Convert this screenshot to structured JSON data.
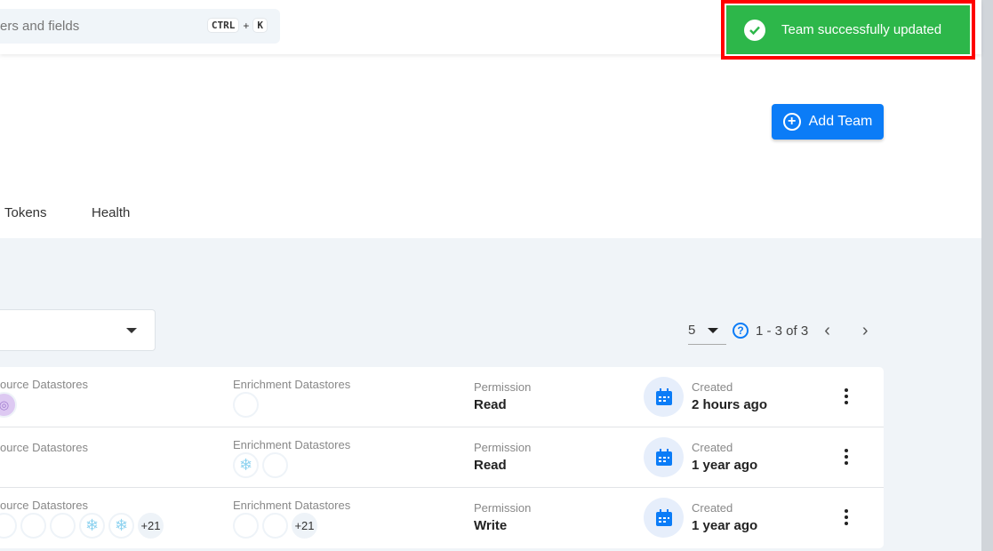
{
  "search": {
    "placeholder": "ers and fields",
    "shortcut_key1": "CTRL",
    "shortcut_plus": "+",
    "shortcut_key2": "K"
  },
  "toast": {
    "message": "Team successfully updated",
    "color": "#2db74a"
  },
  "header": {
    "add_team_label": "Add Team",
    "accent": "#0b7cf7"
  },
  "tabs": [
    {
      "label": "Tokens"
    },
    {
      "label": "Health"
    }
  ],
  "pagination": {
    "per_page": "5",
    "range": "1 - 3 of 3"
  },
  "rows": [
    {
      "source_label": "ource Datastores",
      "enrich_label": "Enrichment Datastores",
      "perm_label": "Permission",
      "permission": "Read",
      "created_label": "Created",
      "created": "2 hours ago",
      "enrich_more": ""
    },
    {
      "source_label": "ource Datastores",
      "enrich_label": "Enrichment Datastores",
      "perm_label": "Permission",
      "permission": "Read",
      "created_label": "Created",
      "created": "1 year ago"
    },
    {
      "source_label": "ource Datastores",
      "enrich_label": "Enrichment Datastores",
      "perm_label": "Permission",
      "permission": "Write",
      "created_label": "Created",
      "created": "1 year ago",
      "source_more": "+21",
      "enrich_more": "+21"
    }
  ]
}
